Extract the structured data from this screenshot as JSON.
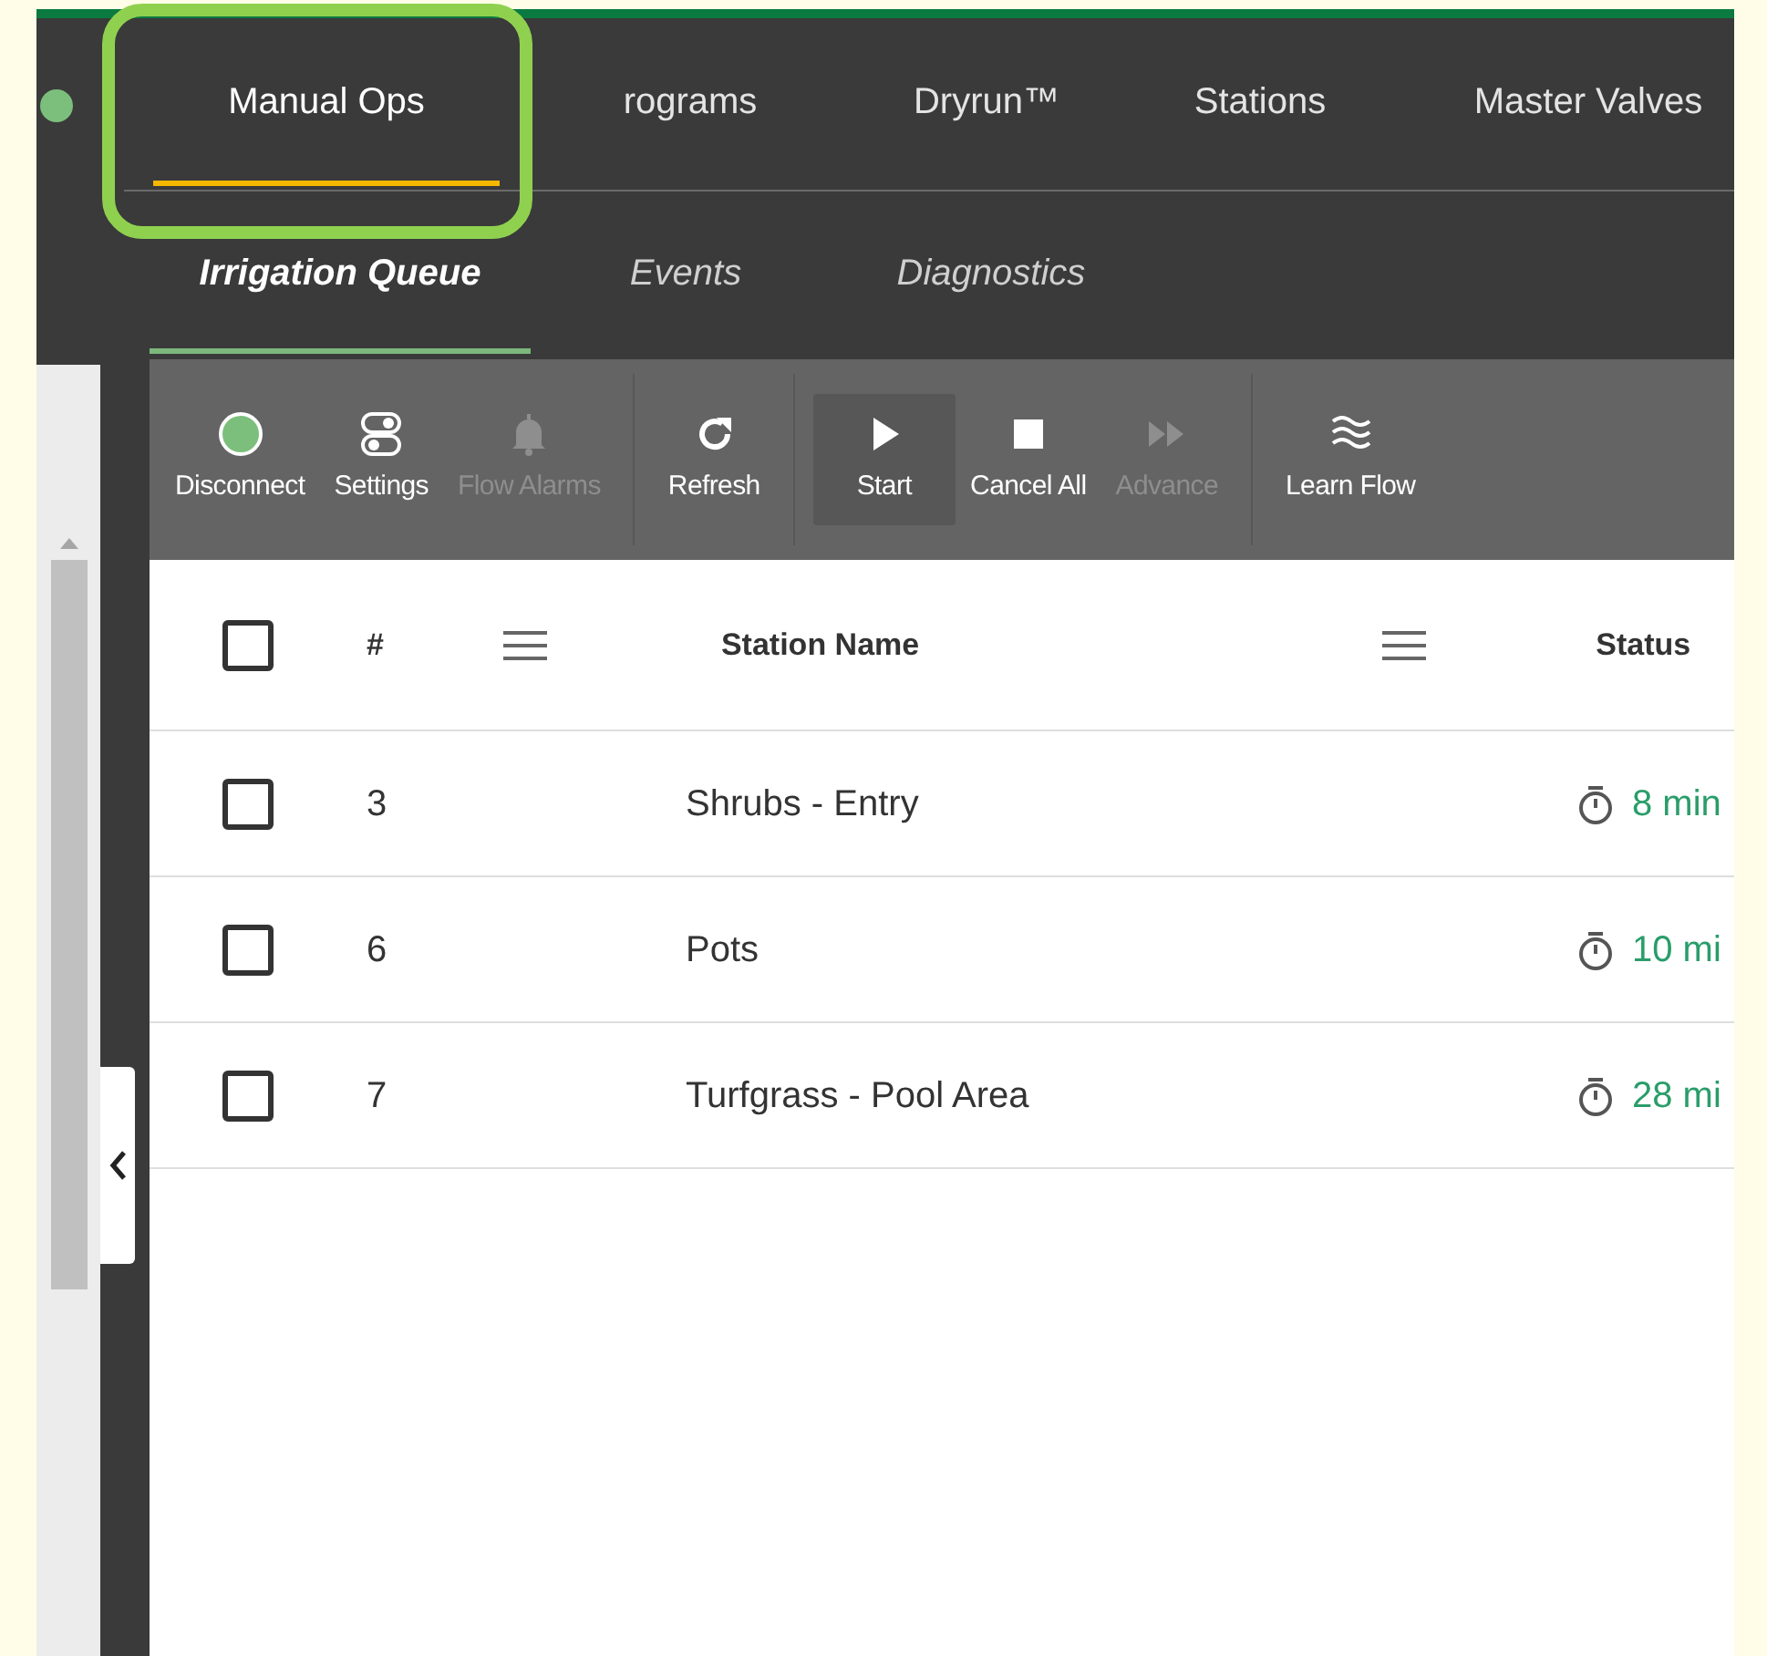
{
  "top_tabs": [
    {
      "label": "Manual Ops",
      "selected": true,
      "highlighted": true
    },
    {
      "label": "rograms",
      "selected": false,
      "highlighted": false
    },
    {
      "label": "Dryrun™",
      "selected": false,
      "highlighted": false
    },
    {
      "label": "Stations",
      "selected": false,
      "highlighted": false
    },
    {
      "label": "Master Valves",
      "selected": false,
      "highlighted": false
    }
  ],
  "sub_tabs": [
    {
      "label": "Irrigation Queue",
      "selected": true
    },
    {
      "label": "Events",
      "selected": false
    },
    {
      "label": "Diagnostics",
      "selected": false
    }
  ],
  "toolbar": [
    {
      "kind": "status",
      "label": "Disconnect",
      "disabled": false,
      "selected": false,
      "separator_before": false
    },
    {
      "kind": "settings",
      "label": "Settings",
      "disabled": false,
      "selected": false,
      "separator_before": false
    },
    {
      "kind": "bell",
      "label": "Flow Alarms",
      "disabled": true,
      "selected": false,
      "separator_before": false
    },
    {
      "kind": "refresh",
      "label": "Refresh",
      "disabled": false,
      "selected": false,
      "separator_before": true
    },
    {
      "kind": "play",
      "label": "Start",
      "disabled": false,
      "selected": true,
      "separator_before": true
    },
    {
      "kind": "stop",
      "label": "Cancel All",
      "disabled": false,
      "selected": false,
      "separator_before": false
    },
    {
      "kind": "forward",
      "label": "Advance",
      "disabled": true,
      "selected": false,
      "separator_before": false
    },
    {
      "kind": "waves",
      "label": "Learn Flow",
      "disabled": false,
      "selected": false,
      "separator_before": true
    }
  ],
  "table": {
    "select_all_checked": false,
    "header": [
      {
        "kind": "label",
        "label": "#"
      },
      {
        "kind": "menu"
      },
      {
        "kind": "label",
        "label": "Station Name"
      },
      {
        "kind": "menu"
      },
      {
        "kind": "label",
        "label": "Status"
      }
    ],
    "rows": [
      {
        "checked": false,
        "number": "3",
        "name": "Shrubs - Entry",
        "status": "8 min"
      },
      {
        "checked": false,
        "number": "6",
        "name": "Pots",
        "status": "10 mi"
      },
      {
        "checked": false,
        "number": "7",
        "name": "Turfgrass - Pool Area",
        "status": "28 mi"
      }
    ]
  }
}
